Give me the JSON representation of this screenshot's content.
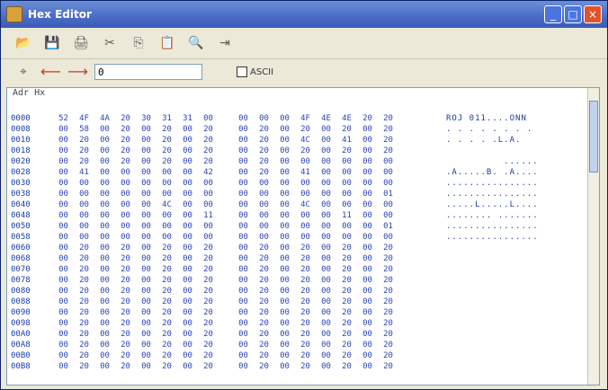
{
  "window": {
    "title": "Hex Editor"
  },
  "toolbar": {
    "icons": [
      "open-icon",
      "save-icon",
      "print-icon",
      "cut-icon",
      "copy-icon",
      "paste-icon",
      "find-icon",
      "goto-icon"
    ]
  },
  "search": {
    "value": "0",
    "checkbox_label": "ASCII"
  },
  "view": {
    "header": "Adr  Hx"
  },
  "rows": [
    {
      "addr": "0000",
      "bytes": [
        "52",
        "4F",
        "4A",
        "20",
        "30",
        "31",
        "31",
        "00",
        "00",
        "00",
        "00",
        "4F",
        "4E",
        "4E",
        "20",
        "20"
      ],
      "ascii": "ROJ 011....ONN  "
    },
    {
      "addr": "0008",
      "bytes": [
        "00",
        "58",
        "00",
        "20",
        "00",
        "20",
        "00",
        "20",
        "00",
        "20",
        "00",
        "20",
        "00",
        "20",
        "00",
        "20"
      ],
      "ascii": ". . . . . . . . "
    },
    {
      "addr": "0010",
      "bytes": [
        "00",
        "20",
        "00",
        "20",
        "00",
        "20",
        "00",
        "20",
        "00",
        "20",
        "00",
        "4C",
        "00",
        "41",
        "00",
        "20"
      ],
      "ascii": ". . . . .L.A.  "
    },
    {
      "addr": "0018",
      "bytes": [
        "00",
        "20",
        "00",
        "20",
        "00",
        "20",
        "00",
        "20",
        "00",
        "20",
        "00",
        "20",
        "00",
        "20",
        "00",
        "20"
      ],
      "ascii": "                "
    },
    {
      "addr": "0020",
      "bytes": [
        "00",
        "20",
        "00",
        "20",
        "00",
        "20",
        "00",
        "20",
        "00",
        "20",
        "00",
        "00",
        "00",
        "00",
        "00",
        "00"
      ],
      "ascii": "          ......"
    },
    {
      "addr": "0028",
      "bytes": [
        "00",
        "41",
        "00",
        "00",
        "00",
        "00",
        "00",
        "42",
        "00",
        "20",
        "00",
        "41",
        "00",
        "00",
        "00",
        "00"
      ],
      "ascii": ".A.....B. .A...."
    },
    {
      "addr": "0030",
      "bytes": [
        "00",
        "00",
        "00",
        "00",
        "00",
        "00",
        "00",
        "00",
        "00",
        "00",
        "00",
        "00",
        "00",
        "00",
        "00",
        "00"
      ],
      "ascii": "................"
    },
    {
      "addr": "0038",
      "bytes": [
        "00",
        "00",
        "00",
        "00",
        "00",
        "00",
        "00",
        "00",
        "00",
        "00",
        "00",
        "00",
        "00",
        "00",
        "00",
        "01"
      ],
      "ascii": "................"
    },
    {
      "addr": "0040",
      "bytes": [
        "00",
        "00",
        "00",
        "00",
        "00",
        "4C",
        "00",
        "00",
        "00",
        "00",
        "00",
        "4C",
        "00",
        "00",
        "00",
        "00"
      ],
      "ascii": ".....L.....L...."
    },
    {
      "addr": "0048",
      "bytes": [
        "00",
        "00",
        "00",
        "00",
        "00",
        "00",
        "00",
        "11",
        "00",
        "00",
        "00",
        "00",
        "00",
        "11",
        "00",
        "00"
      ],
      "ascii": "........ ......."
    },
    {
      "addr": "0050",
      "bytes": [
        "00",
        "00",
        "00",
        "00",
        "00",
        "00",
        "00",
        "00",
        "00",
        "00",
        "00",
        "00",
        "00",
        "00",
        "00",
        "01"
      ],
      "ascii": "................"
    },
    {
      "addr": "0058",
      "bytes": [
        "00",
        "00",
        "00",
        "00",
        "00",
        "00",
        "00",
        "00",
        "00",
        "00",
        "00",
        "00",
        "00",
        "00",
        "00",
        "00"
      ],
      "ascii": "................"
    },
    {
      "addr": "0060",
      "bytes": [
        "00",
        "20",
        "00",
        "20",
        "00",
        "20",
        "00",
        "20",
        "00",
        "20",
        "00",
        "20",
        "00",
        "20",
        "00",
        "20"
      ],
      "ascii": "                "
    },
    {
      "addr": "0068",
      "bytes": [
        "00",
        "20",
        "00",
        "20",
        "00",
        "20",
        "00",
        "20",
        "00",
        "20",
        "00",
        "20",
        "00",
        "20",
        "00",
        "20"
      ],
      "ascii": "                "
    },
    {
      "addr": "0070",
      "bytes": [
        "00",
        "20",
        "00",
        "20",
        "00",
        "20",
        "00",
        "20",
        "00",
        "20",
        "00",
        "20",
        "00",
        "20",
        "00",
        "20"
      ],
      "ascii": "                "
    },
    {
      "addr": "0078",
      "bytes": [
        "00",
        "20",
        "00",
        "20",
        "00",
        "20",
        "00",
        "20",
        "00",
        "20",
        "00",
        "20",
        "00",
        "20",
        "00",
        "20"
      ],
      "ascii": "                "
    },
    {
      "addr": "0080",
      "bytes": [
        "00",
        "20",
        "00",
        "20",
        "00",
        "20",
        "00",
        "20",
        "00",
        "20",
        "00",
        "20",
        "00",
        "20",
        "00",
        "20"
      ],
      "ascii": "                "
    },
    {
      "addr": "0088",
      "bytes": [
        "00",
        "20",
        "00",
        "20",
        "00",
        "20",
        "00",
        "20",
        "00",
        "20",
        "00",
        "20",
        "00",
        "20",
        "00",
        "20"
      ],
      "ascii": "                "
    },
    {
      "addr": "0090",
      "bytes": [
        "00",
        "20",
        "00",
        "20",
        "00",
        "20",
        "00",
        "20",
        "00",
        "20",
        "00",
        "20",
        "00",
        "20",
        "00",
        "20"
      ],
      "ascii": "                "
    },
    {
      "addr": "0098",
      "bytes": [
        "00",
        "20",
        "00",
        "20",
        "00",
        "20",
        "00",
        "20",
        "00",
        "20",
        "00",
        "20",
        "00",
        "20",
        "00",
        "20"
      ],
      "ascii": "                "
    },
    {
      "addr": "00A0",
      "bytes": [
        "00",
        "20",
        "00",
        "20",
        "00",
        "20",
        "00",
        "20",
        "00",
        "20",
        "00",
        "20",
        "00",
        "20",
        "00",
        "20"
      ],
      "ascii": "                "
    },
    {
      "addr": "00A8",
      "bytes": [
        "00",
        "20",
        "00",
        "20",
        "00",
        "20",
        "00",
        "20",
        "00",
        "20",
        "00",
        "20",
        "00",
        "20",
        "00",
        "20"
      ],
      "ascii": "                "
    },
    {
      "addr": "00B0",
      "bytes": [
        "00",
        "20",
        "00",
        "20",
        "00",
        "20",
        "00",
        "20",
        "00",
        "20",
        "00",
        "20",
        "00",
        "20",
        "00",
        "20"
      ],
      "ascii": "                "
    },
    {
      "addr": "00B8",
      "bytes": [
        "00",
        "20",
        "00",
        "20",
        "00",
        "20",
        "00",
        "20",
        "00",
        "20",
        "00",
        "20",
        "00",
        "20",
        "00",
        "20"
      ],
      "ascii": "                "
    }
  ],
  "colors": {
    "title_gradient_top": "#6b8fd6",
    "hex_text": "#2a45b5",
    "addr_text": "#1a3da6"
  }
}
